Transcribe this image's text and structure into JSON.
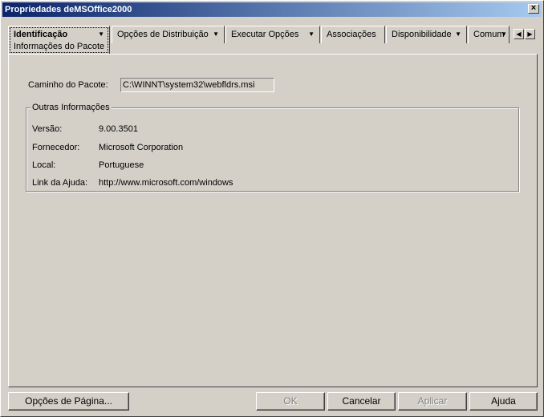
{
  "window": {
    "title": "Propriedades deMSOffice2000",
    "close_label": "×"
  },
  "tabs": [
    {
      "label": "Identificação",
      "sublabel": "Informações do Pacote",
      "has_dropdown": true,
      "active": true
    },
    {
      "label": "Opções de Distribuição",
      "has_dropdown": true
    },
    {
      "label": "Executar Opções",
      "has_dropdown": true
    },
    {
      "label": "Associações",
      "has_dropdown": false
    },
    {
      "label": "Disponibilidade",
      "has_dropdown": true
    },
    {
      "label": "Comum",
      "has_dropdown": true
    }
  ],
  "tab_scroll": {
    "left": "◀",
    "right": "▶"
  },
  "package": {
    "path_label": "Caminho do Pacote:",
    "path_value": "C:\\WINNT\\system32\\webfldrs.msi"
  },
  "other_info": {
    "title": "Outras Informações",
    "rows": [
      {
        "label": "Versão:",
        "value": "9.00.3501"
      },
      {
        "label": "Fornecedor:",
        "value": "Microsoft Corporation"
      },
      {
        "label": "Local:",
        "value": "Portuguese"
      },
      {
        "label": "Link da Ajuda:",
        "value": "http://www.microsoft.com/windows"
      }
    ]
  },
  "buttons": {
    "page_options": "Opções de Página...",
    "ok": "OK",
    "cancel": "Cancelar",
    "apply": "Aplicar",
    "help": "Ajuda"
  },
  "colors": {
    "face": "#d4d0c8",
    "title_start": "#0a246a",
    "title_end": "#a6caf0"
  }
}
